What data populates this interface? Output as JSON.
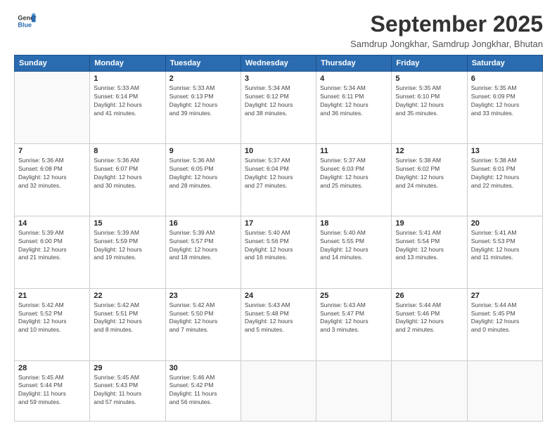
{
  "logo": {
    "general": "General",
    "blue": "Blue"
  },
  "header": {
    "month": "September 2025",
    "subtitle": "Samdrup Jongkhar, Samdrup Jongkhar, Bhutan"
  },
  "weekdays": [
    "Sunday",
    "Monday",
    "Tuesday",
    "Wednesday",
    "Thursday",
    "Friday",
    "Saturday"
  ],
  "weeks": [
    [
      {
        "day": "",
        "info": ""
      },
      {
        "day": "1",
        "info": "Sunrise: 5:33 AM\nSunset: 6:14 PM\nDaylight: 12 hours\nand 41 minutes."
      },
      {
        "day": "2",
        "info": "Sunrise: 5:33 AM\nSunset: 6:13 PM\nDaylight: 12 hours\nand 39 minutes."
      },
      {
        "day": "3",
        "info": "Sunrise: 5:34 AM\nSunset: 6:12 PM\nDaylight: 12 hours\nand 38 minutes."
      },
      {
        "day": "4",
        "info": "Sunrise: 5:34 AM\nSunset: 6:11 PM\nDaylight: 12 hours\nand 36 minutes."
      },
      {
        "day": "5",
        "info": "Sunrise: 5:35 AM\nSunset: 6:10 PM\nDaylight: 12 hours\nand 35 minutes."
      },
      {
        "day": "6",
        "info": "Sunrise: 5:35 AM\nSunset: 6:09 PM\nDaylight: 12 hours\nand 33 minutes."
      }
    ],
    [
      {
        "day": "7",
        "info": "Sunrise: 5:36 AM\nSunset: 6:08 PM\nDaylight: 12 hours\nand 32 minutes."
      },
      {
        "day": "8",
        "info": "Sunrise: 5:36 AM\nSunset: 6:07 PM\nDaylight: 12 hours\nand 30 minutes."
      },
      {
        "day": "9",
        "info": "Sunrise: 5:36 AM\nSunset: 6:05 PM\nDaylight: 12 hours\nand 28 minutes."
      },
      {
        "day": "10",
        "info": "Sunrise: 5:37 AM\nSunset: 6:04 PM\nDaylight: 12 hours\nand 27 minutes."
      },
      {
        "day": "11",
        "info": "Sunrise: 5:37 AM\nSunset: 6:03 PM\nDaylight: 12 hours\nand 25 minutes."
      },
      {
        "day": "12",
        "info": "Sunrise: 5:38 AM\nSunset: 6:02 PM\nDaylight: 12 hours\nand 24 minutes."
      },
      {
        "day": "13",
        "info": "Sunrise: 5:38 AM\nSunset: 6:01 PM\nDaylight: 12 hours\nand 22 minutes."
      }
    ],
    [
      {
        "day": "14",
        "info": "Sunrise: 5:39 AM\nSunset: 6:00 PM\nDaylight: 12 hours\nand 21 minutes."
      },
      {
        "day": "15",
        "info": "Sunrise: 5:39 AM\nSunset: 5:59 PM\nDaylight: 12 hours\nand 19 minutes."
      },
      {
        "day": "16",
        "info": "Sunrise: 5:39 AM\nSunset: 5:57 PM\nDaylight: 12 hours\nand 18 minutes."
      },
      {
        "day": "17",
        "info": "Sunrise: 5:40 AM\nSunset: 5:56 PM\nDaylight: 12 hours\nand 16 minutes."
      },
      {
        "day": "18",
        "info": "Sunrise: 5:40 AM\nSunset: 5:55 PM\nDaylight: 12 hours\nand 14 minutes."
      },
      {
        "day": "19",
        "info": "Sunrise: 5:41 AM\nSunset: 5:54 PM\nDaylight: 12 hours\nand 13 minutes."
      },
      {
        "day": "20",
        "info": "Sunrise: 5:41 AM\nSunset: 5:53 PM\nDaylight: 12 hours\nand 11 minutes."
      }
    ],
    [
      {
        "day": "21",
        "info": "Sunrise: 5:42 AM\nSunset: 5:52 PM\nDaylight: 12 hours\nand 10 minutes."
      },
      {
        "day": "22",
        "info": "Sunrise: 5:42 AM\nSunset: 5:51 PM\nDaylight: 12 hours\nand 8 minutes."
      },
      {
        "day": "23",
        "info": "Sunrise: 5:42 AM\nSunset: 5:50 PM\nDaylight: 12 hours\nand 7 minutes."
      },
      {
        "day": "24",
        "info": "Sunrise: 5:43 AM\nSunset: 5:48 PM\nDaylight: 12 hours\nand 5 minutes."
      },
      {
        "day": "25",
        "info": "Sunrise: 5:43 AM\nSunset: 5:47 PM\nDaylight: 12 hours\nand 3 minutes."
      },
      {
        "day": "26",
        "info": "Sunrise: 5:44 AM\nSunset: 5:46 PM\nDaylight: 12 hours\nand 2 minutes."
      },
      {
        "day": "27",
        "info": "Sunrise: 5:44 AM\nSunset: 5:45 PM\nDaylight: 12 hours\nand 0 minutes."
      }
    ],
    [
      {
        "day": "28",
        "info": "Sunrise: 5:45 AM\nSunset: 5:44 PM\nDaylight: 11 hours\nand 59 minutes."
      },
      {
        "day": "29",
        "info": "Sunrise: 5:45 AM\nSunset: 5:43 PM\nDaylight: 11 hours\nand 57 minutes."
      },
      {
        "day": "30",
        "info": "Sunrise: 5:46 AM\nSunset: 5:42 PM\nDaylight: 11 hours\nand 56 minutes."
      },
      {
        "day": "",
        "info": ""
      },
      {
        "day": "",
        "info": ""
      },
      {
        "day": "",
        "info": ""
      },
      {
        "day": "",
        "info": ""
      }
    ]
  ]
}
